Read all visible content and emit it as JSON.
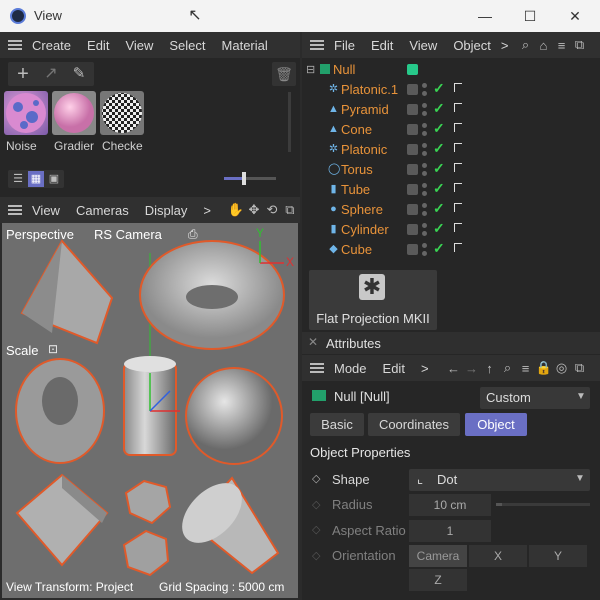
{
  "window": {
    "title": "View"
  },
  "material_panel": {
    "menu": [
      "Create",
      "Edit",
      "View",
      "Select",
      "Material"
    ],
    "materials": [
      {
        "label": "Noise"
      },
      {
        "label": "Gradier"
      },
      {
        "label": "Checke"
      }
    ]
  },
  "viewport": {
    "menu": [
      "View",
      "Cameras",
      "Display"
    ],
    "more": ">",
    "perspective_label": "Perspective",
    "camera_label": "RS Camera",
    "scale_label": "Scale",
    "axis_y": "Y",
    "axis_x": "X",
    "status_left": "View Transform: Project",
    "status_right": "Grid Spacing : 5000 cm"
  },
  "object_manager": {
    "menu": [
      "File",
      "Edit",
      "View",
      "Object"
    ],
    "more": ">",
    "root": "Null",
    "objects": [
      {
        "name": "Platonic.1",
        "icon": "platonic-icon",
        "glyph": "✲"
      },
      {
        "name": "Pyramid",
        "icon": "pyramid-icon",
        "glyph": "▲"
      },
      {
        "name": "Cone",
        "icon": "cone-icon",
        "glyph": "▲"
      },
      {
        "name": "Platonic",
        "icon": "platonic-icon",
        "glyph": "✲"
      },
      {
        "name": "Torus",
        "icon": "torus-icon",
        "glyph": "◯"
      },
      {
        "name": "Tube",
        "icon": "tube-icon",
        "glyph": "▮"
      },
      {
        "name": "Sphere",
        "icon": "sphere-icon",
        "glyph": "●"
      },
      {
        "name": "Cylinder",
        "icon": "cylinder-icon",
        "glyph": "▮"
      },
      {
        "name": "Cube",
        "icon": "cube-icon",
        "glyph": "◆"
      }
    ],
    "tag_label": "Flat Projection MKII"
  },
  "attributes": {
    "tab_title": "Attributes",
    "menu": [
      "Mode",
      "Edit"
    ],
    "more": ">",
    "object_title": "Null [Null]",
    "preset": "Custom",
    "tabs": [
      "Basic",
      "Coordinates",
      "Object"
    ],
    "active_tab": "Object",
    "section": "Object Properties",
    "shape_label": "Shape",
    "shape_value": "Dot",
    "radius_label": "Radius",
    "radius_value": "10 cm",
    "aspect_label": "Aspect Ratio",
    "aspect_value": "1",
    "orientation_label": "Orientation",
    "orientation_options": [
      "Camera",
      "X",
      "Y",
      "Z"
    ]
  },
  "colors": {
    "accent": "#6a6fc4",
    "object_name": "#e8933a",
    "enabled_tick": "#39d353",
    "selection_outline": "#e05a2a",
    "axis_x": "#e03030",
    "axis_y": "#30c030"
  }
}
